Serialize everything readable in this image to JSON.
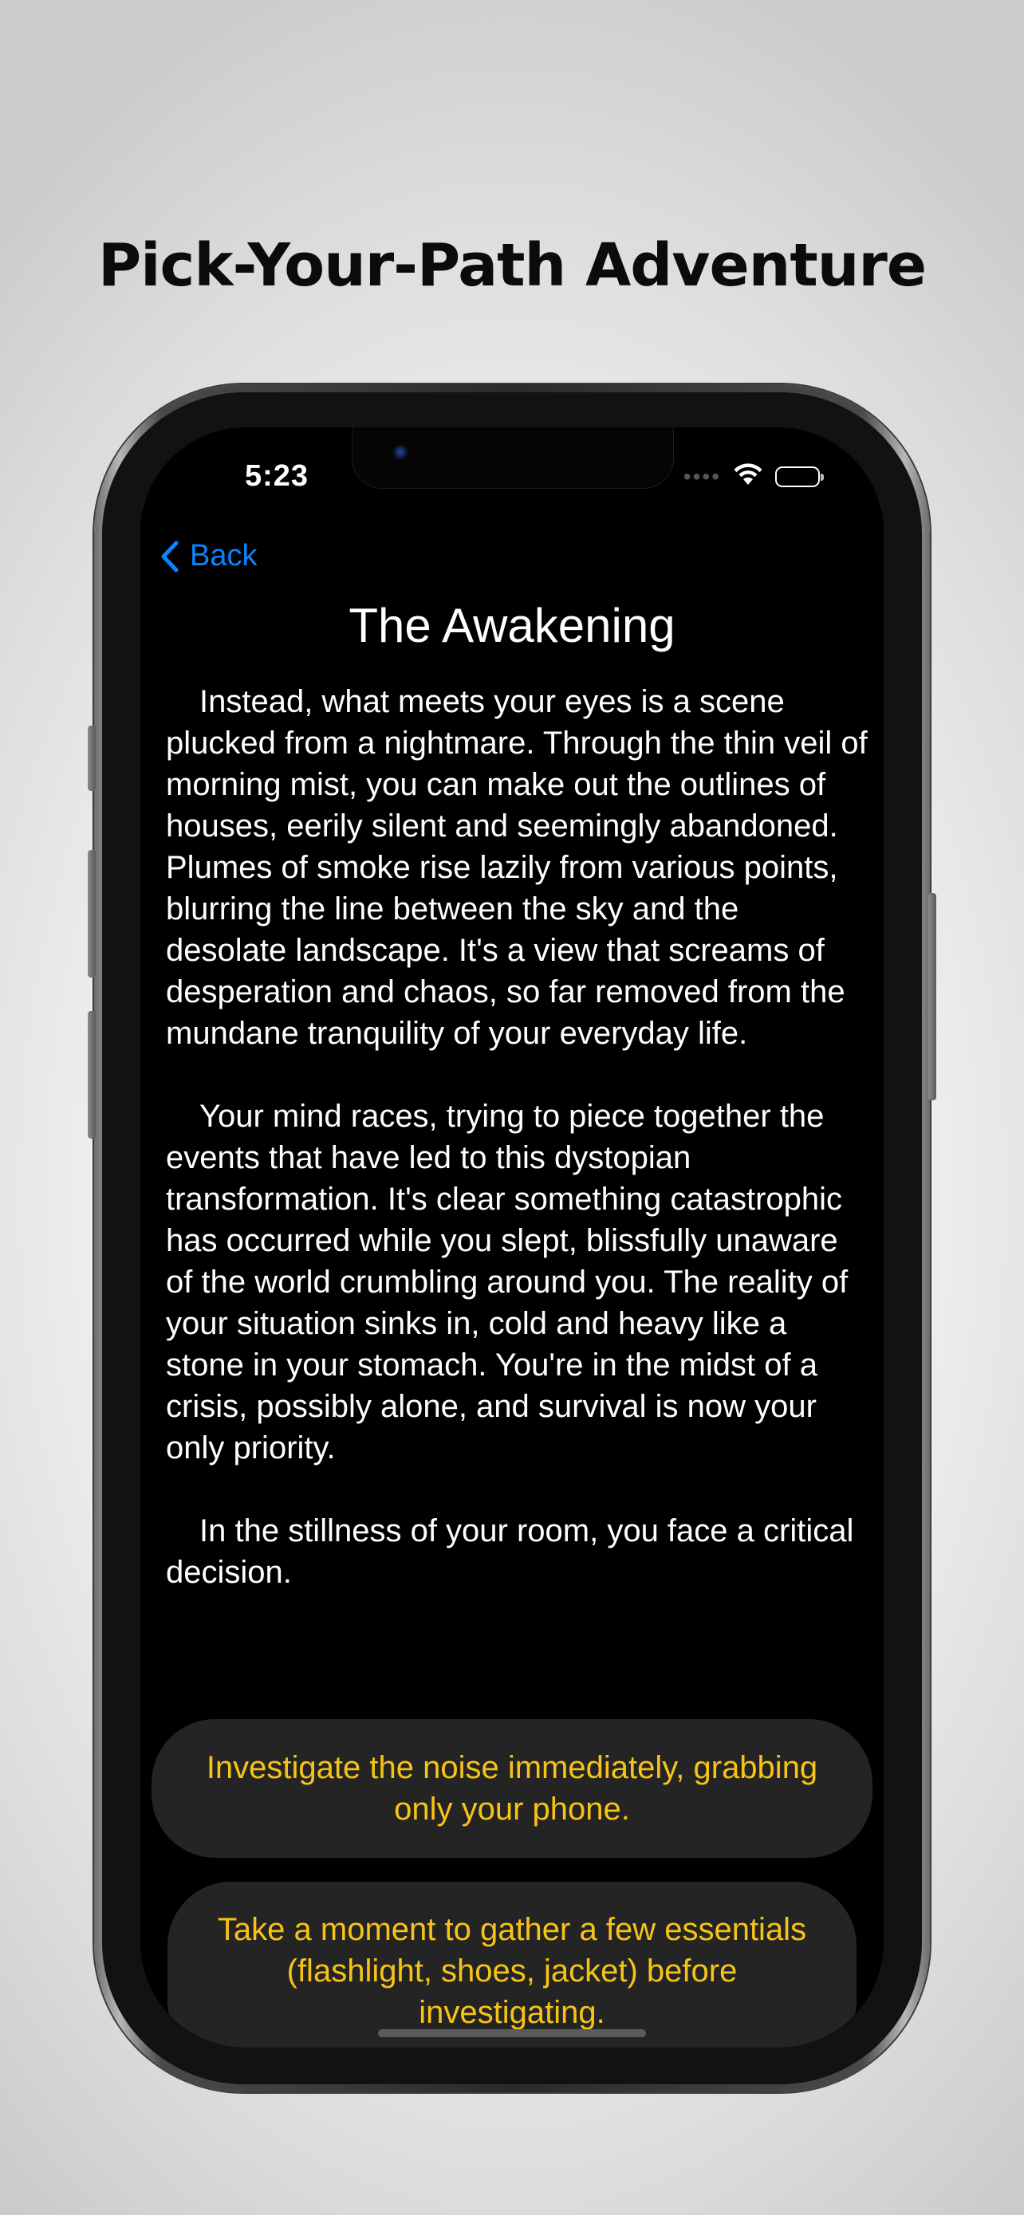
{
  "promo": {
    "title": "Pick-Your-Path Adventure"
  },
  "status_bar": {
    "time": "5:23",
    "icons": [
      "signal-icon",
      "wifi-icon",
      "battery-icon"
    ]
  },
  "nav": {
    "back_label": "Back",
    "back_icon": "chevron-left-icon",
    "accent_color": "#0a84ff"
  },
  "story": {
    "title": "The Awakening",
    "paragraphs": [
      "Instead, what meets your eyes is a scene plucked from a nightmare. Through the thin veil of morning mist, you can make out the outlines of houses, eerily silent and seemingly abandoned. Plumes of smoke rise lazily from various points, blurring the line between the sky and the desolate landscape. It's a view that screams of desperation and chaos, so far removed from the mundane tranquility of your everyday life.",
      "Your mind races, trying to piece together the events that have led to this dystopian transformation. It's clear something catastrophic has occurred while you slept, blissfully unaware of the world crumbling around you. The reality of your situation sinks in, cold and heavy like a stone in your stomach. You're in the midst of a crisis, possibly alone, and survival is now your only priority.",
      "In the stillness of your room, you face a critical decision."
    ]
  },
  "choices": [
    {
      "label": "Investigate the noise immediately, grabbing only your phone."
    },
    {
      "label": "Take a moment to gather a few essentials (flashlight, shoes, jacket) before investigating."
    }
  ],
  "colors": {
    "choice_text": "#f7c416",
    "choice_background": "#242424",
    "screen_background": "#000000"
  }
}
